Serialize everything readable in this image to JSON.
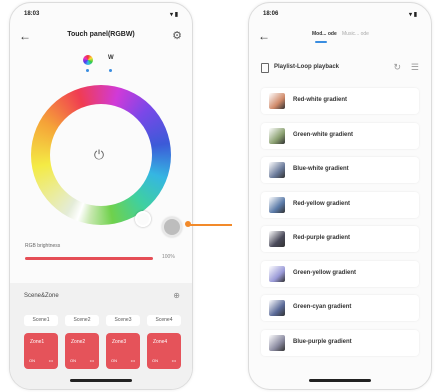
{
  "left_screen": {
    "status_time": "18:03",
    "status_icons": "▾ ▮",
    "title": "Touch panel(RGBW)",
    "mode_w_label": "W",
    "brightness_label": "RGB brightness",
    "brightness_value": "100%",
    "brightness_fraction": 1.0,
    "scene_label": "Scene&Zone",
    "scenes": [
      "Scene1",
      "Scene2",
      "Scene3",
      "Scene4"
    ],
    "zones": [
      {
        "name": "Zone1",
        "on": "ON",
        "more": "•••"
      },
      {
        "name": "Zone2",
        "on": "ON",
        "more": "•••"
      },
      {
        "name": "Zone3",
        "on": "ON",
        "more": "•••"
      },
      {
        "name": "Zone4",
        "on": "ON",
        "more": "•••"
      }
    ]
  },
  "right_screen": {
    "status_time": "18:06",
    "status_icons": "▾ ▮",
    "tab_active": "Mod... ode",
    "tab_inactive": "Music... ode",
    "subtitle": "Playlist-Loop playback",
    "items": [
      {
        "label": "Red-white gradient",
        "thumb": "#d08a6a"
      },
      {
        "label": "Green-white gradient",
        "thumb": "#8aa070"
      },
      {
        "label": "Blue-white gradient",
        "thumb": "#6a7a9a"
      },
      {
        "label": "Red-yellow gradient",
        "thumb": "#5a7aa8"
      },
      {
        "label": "Red-purple gradient",
        "thumb": "#4a4a5a"
      },
      {
        "label": "Green-yellow gradient",
        "thumb": "#9a9ad8"
      },
      {
        "label": "Green-cyan gradient",
        "thumb": "#5a6a98"
      },
      {
        "label": "Blue-purple gradient",
        "thumb": "#8a8aa0"
      }
    ]
  },
  "colors": {
    "accent_red": "#e5535a",
    "accent_blue": "#3a8de0",
    "connector_orange": "#f28a2a"
  },
  "icons": {
    "back": "←",
    "gear": "⚙",
    "power": "⏻",
    "add": "⊕",
    "loop": "↻",
    "list": "☰"
  }
}
